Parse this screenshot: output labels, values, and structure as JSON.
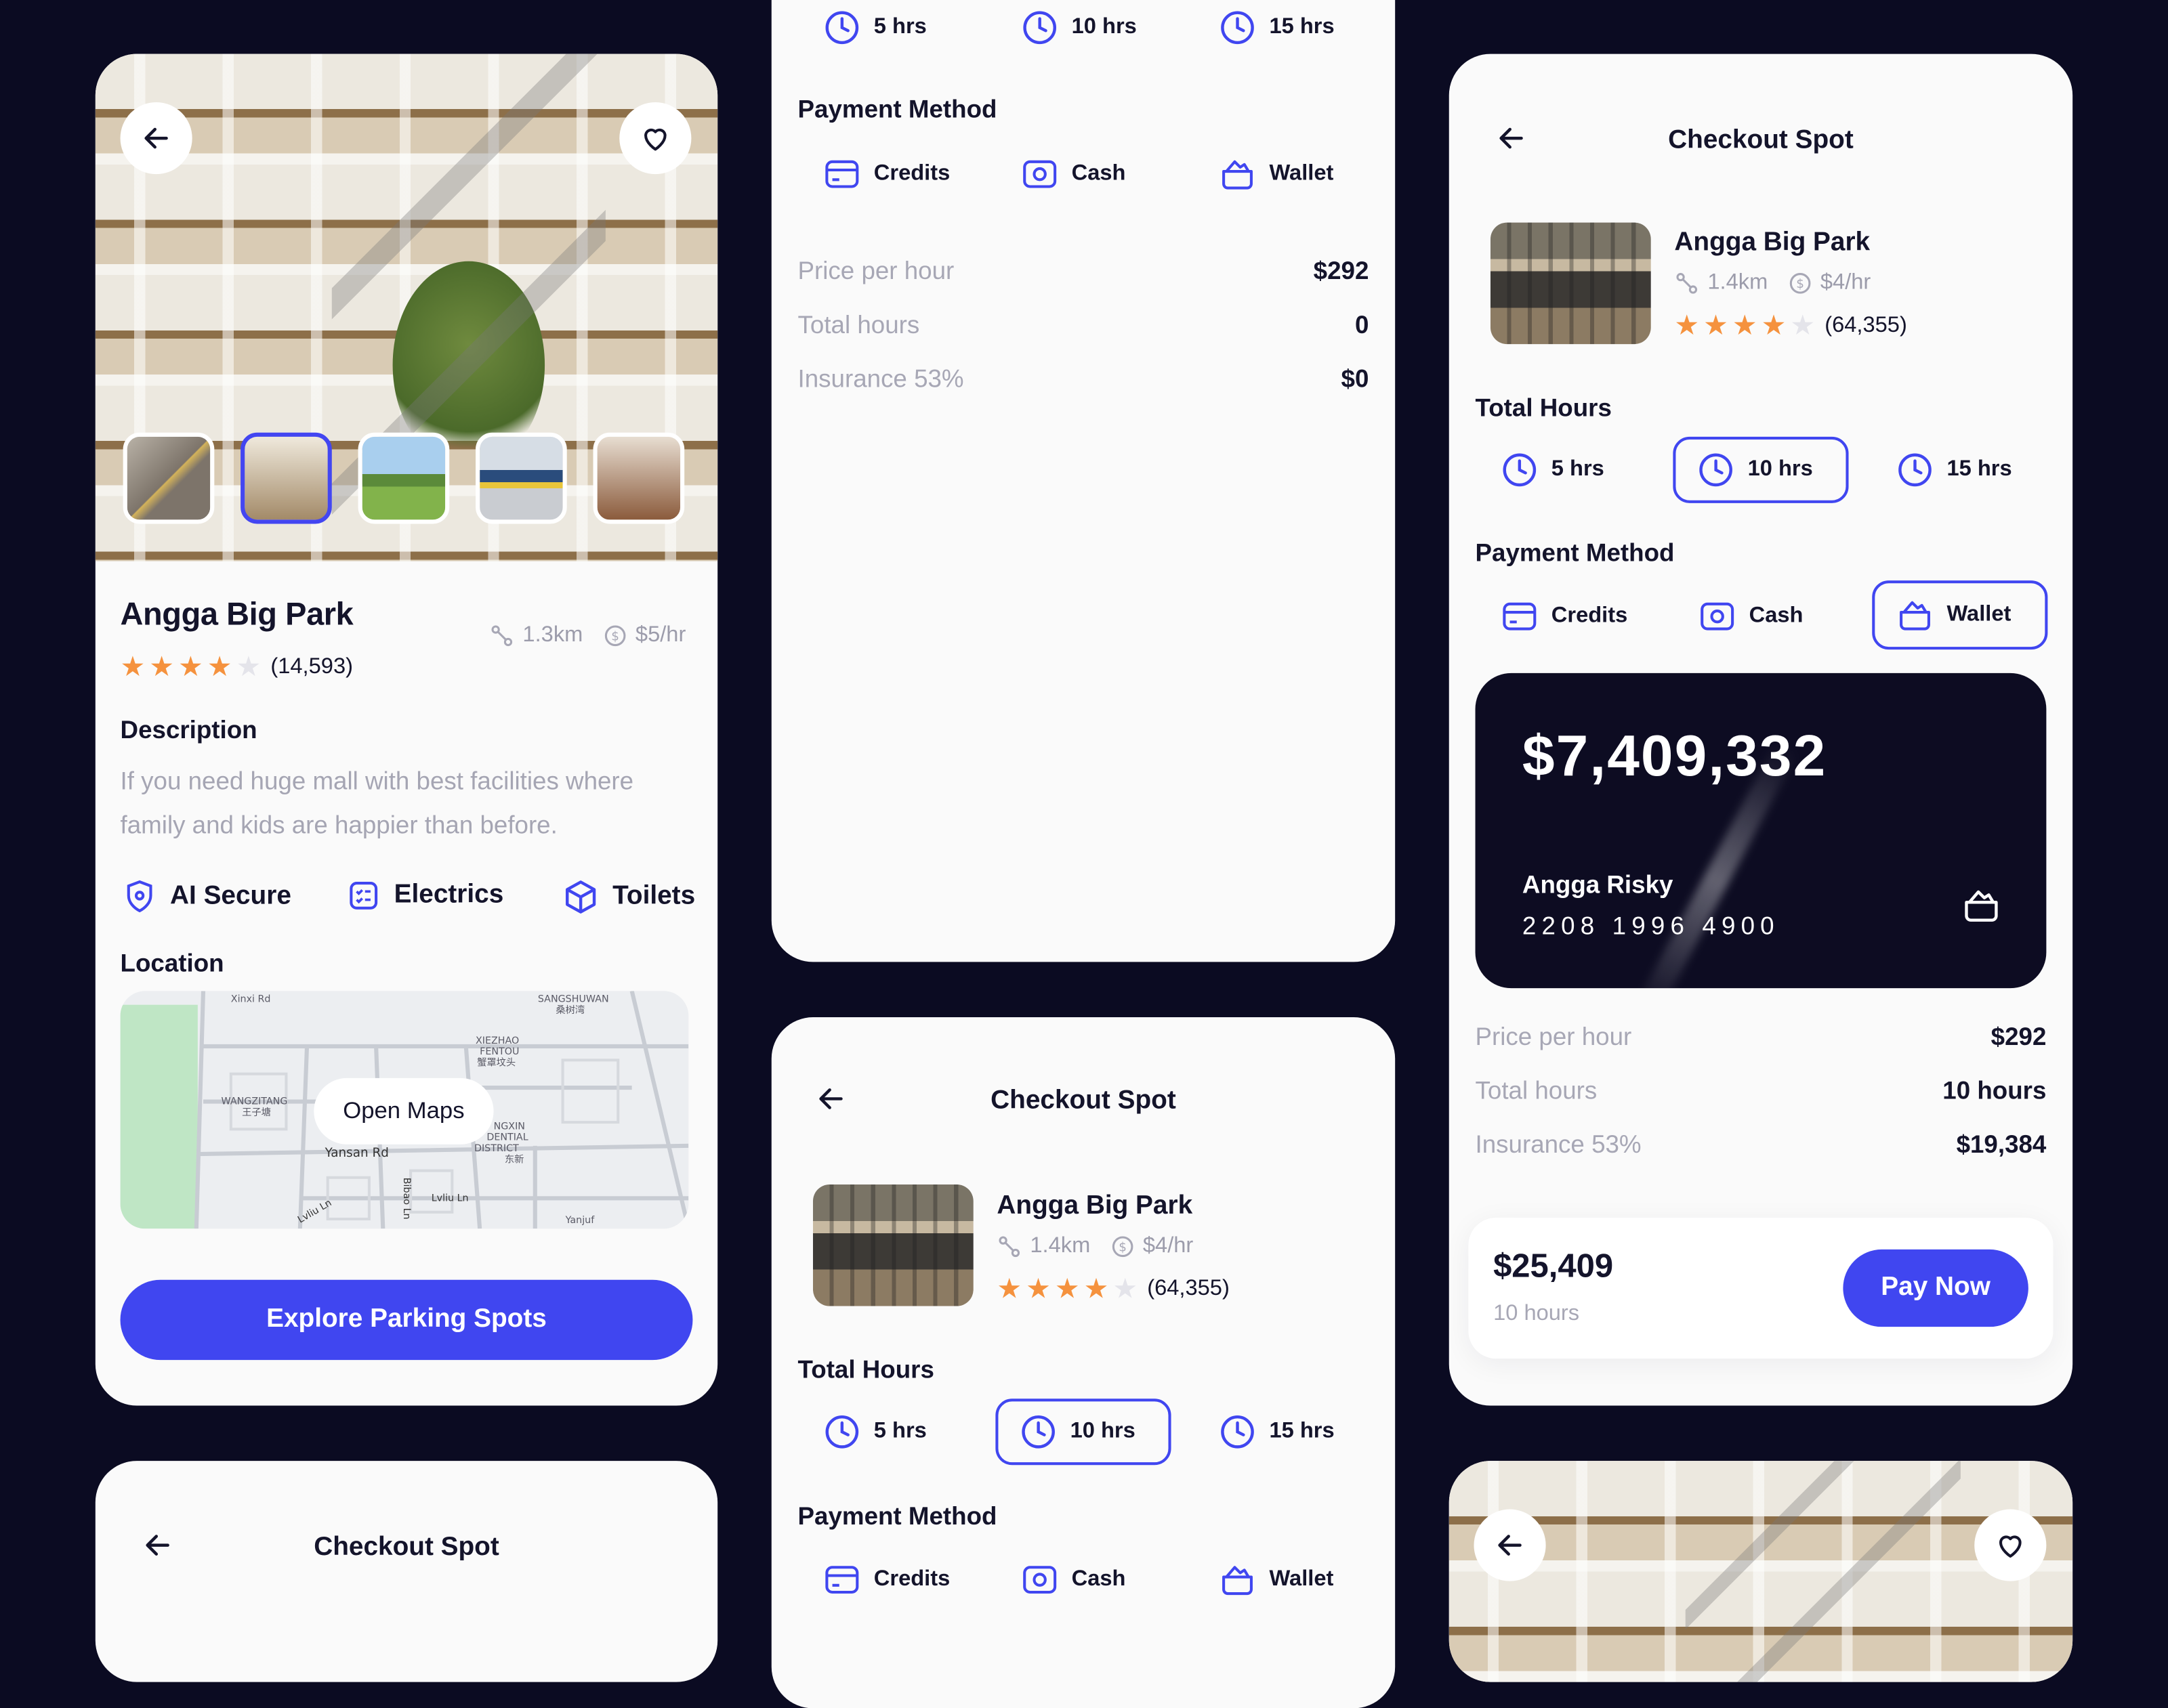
{
  "colors": {
    "background": "#0b0b22",
    "primary": "#4046f0",
    "card": "#fafafa",
    "star": "#f5923e",
    "dark_card": "#0d0c22"
  },
  "detail": {
    "title": "Angga Big Park",
    "rating_count": "(14,593)",
    "rating": 4,
    "distance": "1.3km",
    "price": "$5/hr",
    "description_heading": "Description",
    "description": "If you need huge mall with best facilities where family and kids are happier than before.",
    "features": [
      {
        "label": "AI Secure",
        "icon": "shield-icon"
      },
      {
        "label": "Electrics",
        "icon": "checklist-icon"
      },
      {
        "label": "Toilets",
        "icon": "box-icon"
      }
    ],
    "location_heading": "Location",
    "map": {
      "open_label": "Open Maps",
      "labels": [
        "Xinxi Rd",
        "SANGSHUWAN",
        "桑树湾",
        "XIEZHAO",
        "FENTOU",
        "蟹罩坟头",
        "WANGZITANG",
        "王子塘",
        "NGXIN",
        "DENTIAL",
        "DISTRICT",
        "东新",
        "Yansan Rd",
        "Bibao Ln",
        "Lvliu Ln",
        "Lvliu Ln",
        "Yanjuf"
      ]
    },
    "cta": "Explore Parking Spots"
  },
  "middle_top": {
    "hours": [
      "5 hrs",
      "10 hrs",
      "15 hrs"
    ],
    "payment_heading": "Payment Method",
    "payments": [
      "Credits",
      "Cash",
      "Wallet"
    ],
    "summary": [
      {
        "label": "Price per hour",
        "value": "$292"
      },
      {
        "label": "Total hours",
        "value": "0"
      },
      {
        "label": "Insurance 53%",
        "value": "$0"
      }
    ]
  },
  "checkout_mid": {
    "title": "Checkout Spot",
    "spot": {
      "name": "Angga Big Park",
      "distance": "1.4km",
      "price": "$4/hr",
      "rating_count": "(64,355)",
      "rating": 4
    },
    "hours_heading": "Total Hours",
    "hours": [
      "5 hrs",
      "10 hrs",
      "15 hrs"
    ],
    "selected_hours": "10 hrs",
    "payment_heading": "Payment Method",
    "payments": [
      "Credits",
      "Cash",
      "Wallet"
    ]
  },
  "checkout_right": {
    "title": "Checkout Spot",
    "spot": {
      "name": "Angga Big Park",
      "distance": "1.4km",
      "price": "$4/hr",
      "rating_count": "(64,355)",
      "rating": 4
    },
    "hours_heading": "Total Hours",
    "hours": [
      "5 hrs",
      "10 hrs",
      "15 hrs"
    ],
    "selected_hours": "10 hrs",
    "payment_heading": "Payment Method",
    "payments": [
      "Credits",
      "Cash",
      "Wallet"
    ],
    "selected_payment": "Wallet",
    "wallet": {
      "balance": "$7,409,332",
      "holder": "Angga Risky",
      "number": "2208 1996 4900"
    },
    "summary": [
      {
        "label": "Price per hour",
        "value": "$292"
      },
      {
        "label": "Total hours",
        "value": "10 hours"
      },
      {
        "label": "Insurance 53%",
        "value": "$19,384"
      }
    ],
    "total": {
      "amount": "$25,409",
      "hours": "10 hours",
      "pay_label": "Pay Now"
    }
  },
  "checkout_bottom_left": {
    "title": "Checkout Spot"
  }
}
